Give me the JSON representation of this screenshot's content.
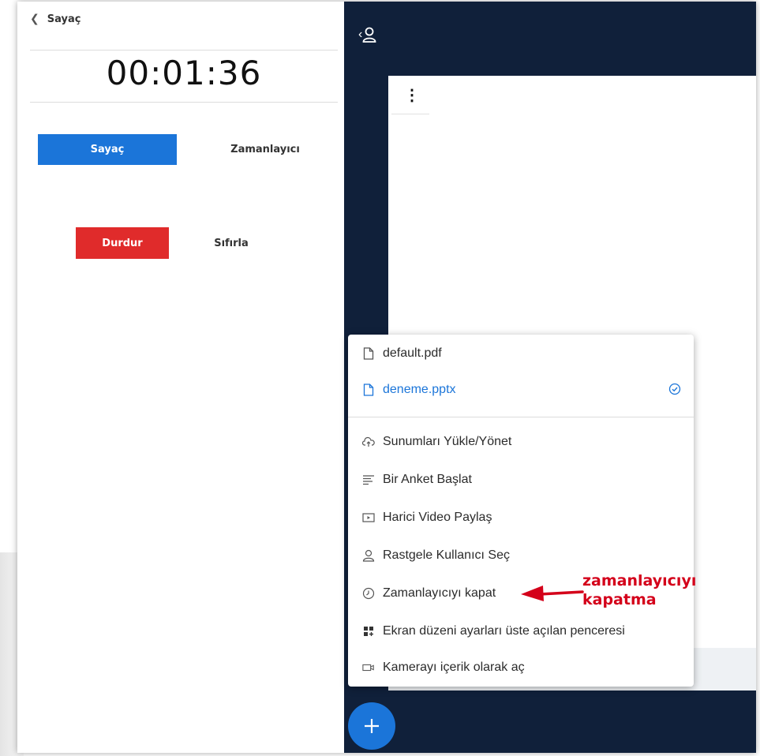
{
  "timer_panel": {
    "back_title": "Sayaç",
    "clock": "00:01:36",
    "mode_buttons": {
      "stopwatch": "Sayaç",
      "timer": "Zamanlayıcı"
    },
    "action_buttons": {
      "stop": "Durdur",
      "reset": "Sıfırla"
    }
  },
  "presentation_menu": {
    "files": [
      {
        "name": "default.pdf",
        "active": false
      },
      {
        "name": "deneme.pptx",
        "active": true
      }
    ],
    "items": [
      {
        "label": "Sunumları Yükle/Yönet",
        "icon": "cloud-upload-icon"
      },
      {
        "label": "Bir Anket Başlat",
        "icon": "poll-icon"
      },
      {
        "label": "Harici Video Paylaş",
        "icon": "video-icon"
      },
      {
        "label": "Rastgele Kullanıcı Seç",
        "icon": "user-icon"
      },
      {
        "label": "Zamanlayıcıyı kapat",
        "icon": "clock-icon"
      },
      {
        "label": "Ekran düzeni ayarları üste açılan penceresi",
        "icon": "layout-icon"
      },
      {
        "label": "Kamerayı içerik olarak aç",
        "icon": "camera-icon"
      }
    ]
  },
  "annotation": {
    "line1": "zamanlayıcıyı",
    "line2": "kapatma",
    "color": "#d4001a"
  },
  "colors": {
    "primary": "#1b75d9",
    "danger": "#e02b2b",
    "dark_panel": "#10203a"
  }
}
